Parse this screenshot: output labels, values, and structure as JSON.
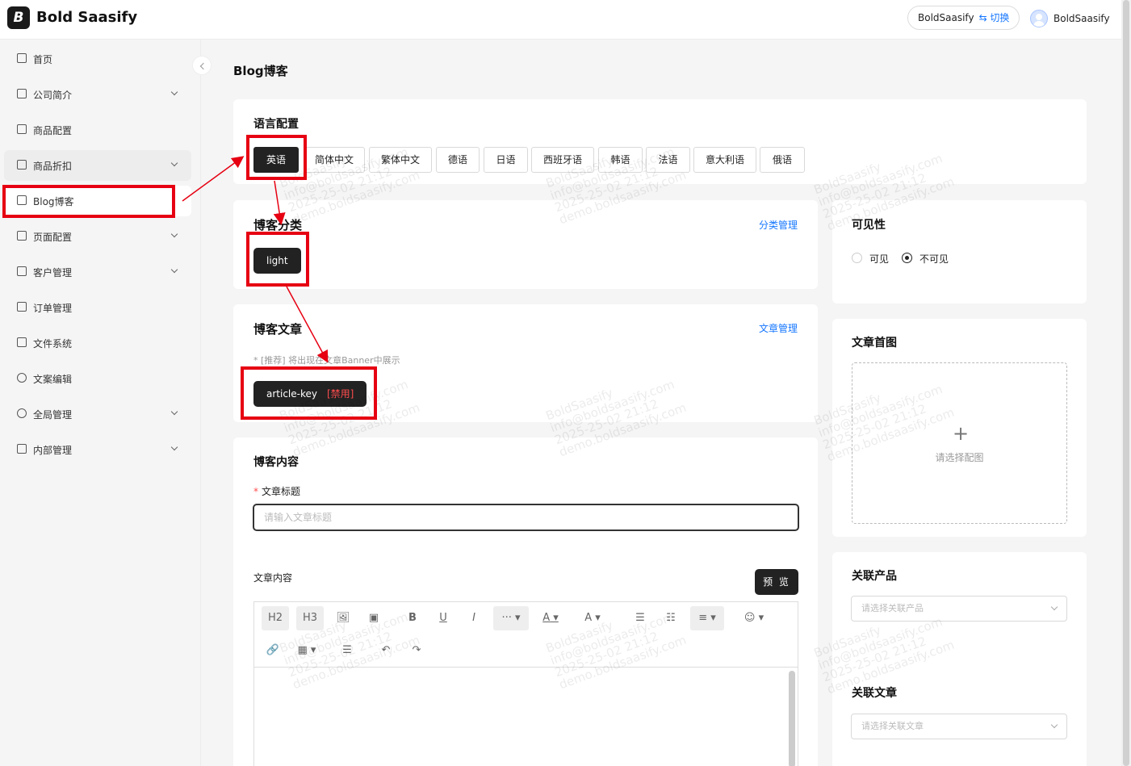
{
  "header": {
    "brand": "Bold Saasify",
    "logo_letter": "B",
    "switch_account": "BoldSaasify",
    "switch_label": "⇆ 切换",
    "user_name": "BoldSaasify"
  },
  "sidebar": {
    "items": [
      {
        "label": "首页",
        "icon": "home-icon",
        "has_children": false
      },
      {
        "label": "公司简介",
        "icon": "building-icon",
        "has_children": true
      },
      {
        "label": "商品配置",
        "icon": "box-icon",
        "has_children": false
      },
      {
        "label": "商品折扣",
        "icon": "tag-icon",
        "has_children": true
      },
      {
        "label": "Blog博客",
        "icon": "users-icon",
        "has_children": false,
        "active": true
      },
      {
        "label": "页面配置",
        "icon": "monitor-icon",
        "has_children": true
      },
      {
        "label": "客户管理",
        "icon": "users-icon",
        "has_children": true
      },
      {
        "label": "订单管理",
        "icon": "list-icon",
        "has_children": false
      },
      {
        "label": "文件系统",
        "icon": "file-icon",
        "has_children": false
      },
      {
        "label": "文案编辑",
        "icon": "globe-icon",
        "has_children": false
      },
      {
        "label": "全局管理",
        "icon": "dollar-icon",
        "has_children": true
      },
      {
        "label": "内部管理",
        "icon": "users-icon",
        "has_children": true
      }
    ]
  },
  "main": {
    "page_title": "Blog博客",
    "language": {
      "title": "语言配置",
      "options": [
        "英语",
        "简体中文",
        "繁体中文",
        "德语",
        "日语",
        "西班牙语",
        "韩语",
        "法语",
        "意大利语",
        "俄语"
      ],
      "selected": "英语"
    },
    "category": {
      "title": "博客分类",
      "manage_link": "分类管理",
      "tag": "light"
    },
    "article": {
      "title": "博客文章",
      "manage_link": "文章管理",
      "hint": "* [推荐] 将出现在文章Banner中展示",
      "tag": "article-key",
      "tag_status": "[禁用]"
    },
    "content": {
      "title": "博客内容",
      "title_label": "文章标题",
      "title_placeholder": "请输入文章标题",
      "body_label": "文章内容",
      "preview_button": "预 览",
      "toolbar": {
        "h2": "H2",
        "h3": "H3",
        "bold": "B",
        "underline": "U",
        "italic": "I",
        "more": "···",
        "font_color": "A",
        "bg_color": "A"
      }
    }
  },
  "right": {
    "visibility": {
      "title": "可见性",
      "options": [
        "可见",
        "不可见"
      ],
      "selected": "不可见"
    },
    "cover": {
      "title": "文章首图",
      "placeholder": "请选择配图"
    },
    "related_products": {
      "title": "关联产品",
      "placeholder": "请选择关联产品"
    },
    "related_articles": {
      "title": "关联文章",
      "placeholder": "请选择关联文章"
    }
  },
  "watermark": {
    "line1": "BoldSaasify",
    "line2": "info@boldsaasify.com",
    "line3": "2025-25-02 21:12",
    "line4": "demo.boldsaasify.com"
  },
  "colors": {
    "accent": "#1677ff",
    "dark": "#222222",
    "annotation": "#e60012",
    "danger": "#ff4d4f"
  }
}
